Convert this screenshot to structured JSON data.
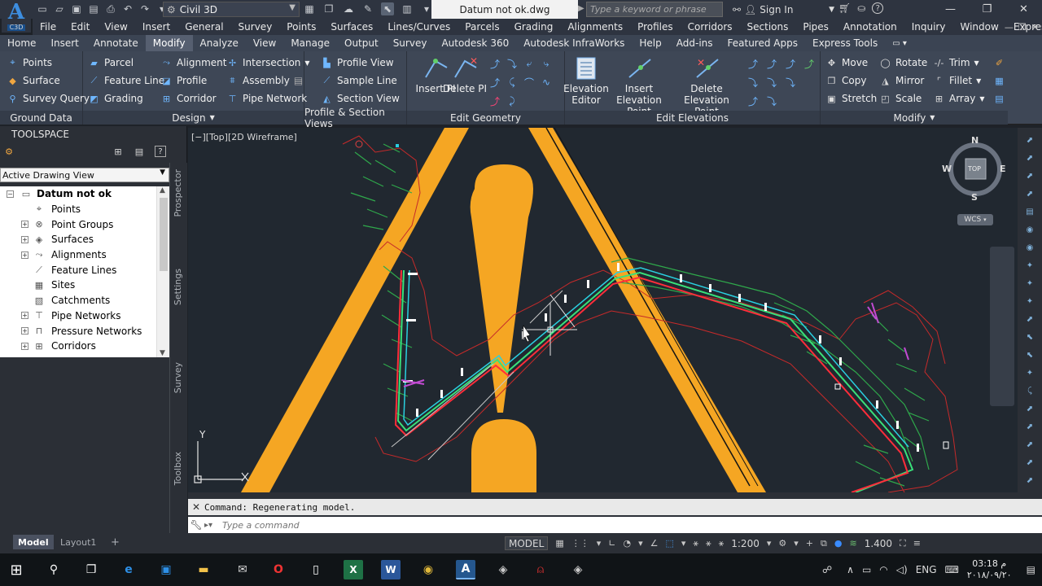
{
  "titlebar": {
    "logo_letter": "A",
    "logo_sub": "C3D",
    "workspace": "Civil 3D",
    "document_title": "Datum not ok.dwg",
    "search_placeholder": "Type a keyword or phrase",
    "sign_in": "Sign In"
  },
  "menubar": [
    "File",
    "Edit",
    "View",
    "Insert",
    "General",
    "Survey",
    "Points",
    "Surfaces",
    "Lines/Curves",
    "Parcels",
    "Grading",
    "Alignments",
    "Profiles",
    "Corridors",
    "Sections",
    "Pipes",
    "Annotation",
    "Inquiry",
    "Window",
    "Express"
  ],
  "ribbon_tabs": [
    "Home",
    "Insert",
    "Annotate",
    "Modify",
    "Analyze",
    "View",
    "Manage",
    "Output",
    "Survey",
    "Autodesk 360",
    "Autodesk InfraWorks",
    "Help",
    "Add-ins",
    "Featured Apps",
    "Express Tools"
  ],
  "active_tab": "Modify",
  "ribbon": {
    "ground_data": {
      "title": "Ground Data",
      "items": [
        "Points",
        "Surface",
        "Survey Query"
      ]
    },
    "design": {
      "title": "Design",
      "col1": [
        "Parcel",
        "Feature Line",
        "Grading"
      ],
      "col2": [
        "Alignment",
        "Profile",
        "Corridor"
      ],
      "col3": [
        "Intersection",
        "Assembly",
        "Pipe Network"
      ]
    },
    "profile_section": {
      "title": "Profile & Section Views",
      "items": [
        "Profile View",
        "Sample Line",
        "Section View"
      ]
    },
    "edit_geometry": {
      "title": "Edit Geometry",
      "insert_pi": "Insert PI",
      "delete_pi": "Delete PI"
    },
    "edit_elevations": {
      "title": "Edit Elevations",
      "elevation_editor": "Elevation Editor",
      "insert_elevation_point": "Insert Elevation Point",
      "delete_elevation_point": "Delete Elevation Point"
    },
    "modify": {
      "title": "Modify",
      "col1": [
        "Move",
        "Copy",
        "Stretch"
      ],
      "col2": [
        "Rotate",
        "Mirror",
        "Scale"
      ],
      "col3": [
        "Trim",
        "Fillet",
        "Array"
      ]
    }
  },
  "toolspace": {
    "title": "TOOLSPACE",
    "view_select": "Active Drawing View",
    "tree_root": "Datum not ok",
    "tree_items": [
      "Points",
      "Point Groups",
      "Surfaces",
      "Alignments",
      "Feature Lines",
      "Sites",
      "Catchments",
      "Pipe Networks",
      "Pressure Networks",
      "Corridors"
    ],
    "side_tabs": [
      "Prospector",
      "Settings",
      "Survey",
      "Toolbox"
    ]
  },
  "viewport": {
    "label": "[−][Top][2D Wireframe]",
    "viewcube": {
      "n": "N",
      "s": "S",
      "e": "E",
      "w": "W",
      "face": "TOP",
      "ucs": "WCS"
    },
    "ucs_y": "Y"
  },
  "command": {
    "history": "Command: Regenerating model.",
    "placeholder": "Type a command"
  },
  "layout_tabs": [
    "Model",
    "Layout1"
  ],
  "status": {
    "model": "MODEL",
    "scale": "1:200",
    "elevation": "1.400"
  },
  "taskbar": {
    "language": "ENG",
    "time": "03:18 م",
    "date": "٢٠١٨/٠٩/٢٠"
  },
  "colors": {
    "accent_tab": "#565f70",
    "warning_sign": "#f5a623",
    "alignment_center": "#ff2d3a",
    "alignment_offset": "#39e07a",
    "contours": "#2fa84b"
  }
}
